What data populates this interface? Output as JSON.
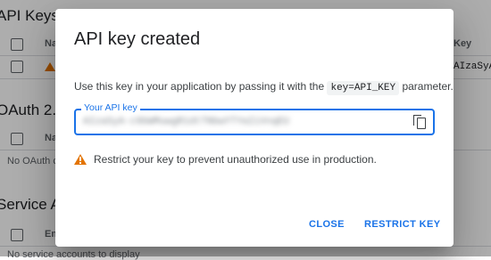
{
  "background": {
    "api_keys_title": "API Keys",
    "api_keys_header_col1": "Na",
    "api_keys_header_col2": "Key",
    "api_key_value_partial": "AIzaSyA",
    "oauth_title": "OAuth 2.0",
    "oauth_header_col1": "Na",
    "oauth_empty": "No OAuth c",
    "service_title": "Service Ac",
    "service_header_col1": "Em",
    "service_empty": "No service accounts to display"
  },
  "dialog": {
    "title": "API key created",
    "description_before": "Use this key in your application by passing it with the ",
    "description_code": "key=API_KEY",
    "description_after": " parameter.",
    "field_label": "Your API key",
    "field_value": "AIzaSyA-c9bWMuwgR1dtTNbwYTYeZiVnqEU",
    "warning_text": "Restrict your key to prevent unauthorized use in production.",
    "close_label": "CLOSE",
    "restrict_label": "RESTRICT KEY"
  },
  "colors": {
    "accent": "#1a73e8",
    "warning": "#e37400"
  },
  "icons": {
    "copy": "copy-icon",
    "warning": "warning-icon"
  }
}
